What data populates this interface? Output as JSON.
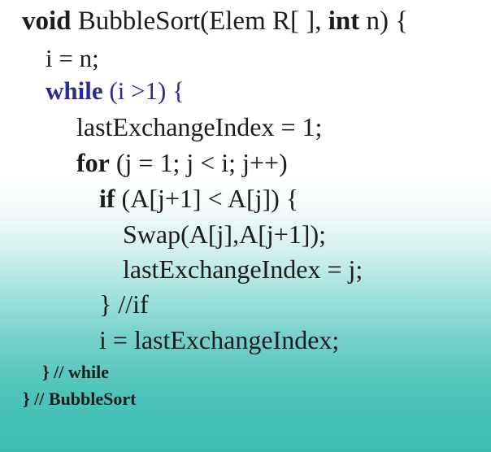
{
  "code": {
    "line0": {
      "kw1": "void",
      "text1": " BubbleSort(Elem R[ ], ",
      "kw2": "int",
      "text2": " n) {"
    },
    "line1": {
      "text": "i = n;"
    },
    "line2": {
      "kw": "while",
      "text": " (i >1) {"
    },
    "line3": {
      "text": "lastExchangeIndex = 1;"
    },
    "line4": {
      "kw": "for",
      "text": " (j = 1; j < i; j++)"
    },
    "line5": {
      "kw": "if",
      "text": " (A[j+1] < A[j]) {"
    },
    "line6": {
      "text": "Swap(A[j],A[j+1]);"
    },
    "line7": {
      "text": "lastExchangeIndex = j;"
    },
    "line8": {
      "text": "} //if"
    },
    "line9": {
      "text": "i = lastExchangeIndex;"
    },
    "line10": {
      "text": "} // while"
    },
    "line11": {
      "text": "} // BubbleSort"
    }
  },
  "colors": {
    "keyword_blue": "#2c2c8c",
    "text": "#1c1c1c",
    "gradient_top": "#ffffff",
    "gradient_bottom": "#3bbdb3"
  }
}
